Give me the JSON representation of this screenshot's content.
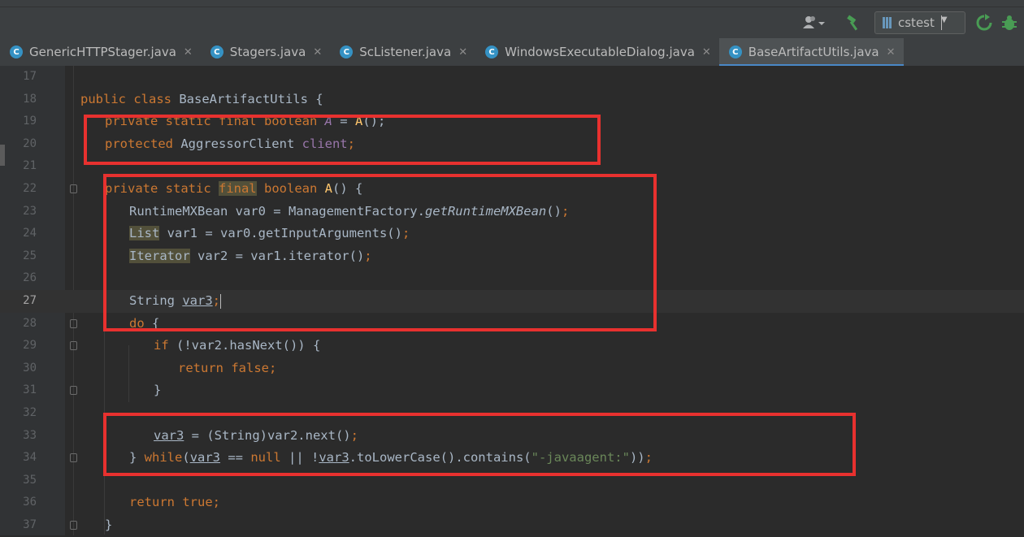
{
  "toolbar": {
    "run_config": "cstest"
  },
  "tabs": [
    {
      "label": "GenericHTTPStager.java",
      "active": false
    },
    {
      "label": "Stagers.java",
      "active": false
    },
    {
      "label": "ScListener.java",
      "active": false
    },
    {
      "label": "WindowsExecutableDialog.java",
      "active": false
    },
    {
      "label": "BaseArtifactUtils.java",
      "active": true
    }
  ],
  "icons": {
    "tab_class": "C",
    "tab_close": "✕"
  },
  "editor": {
    "line_numbers": [
      "17",
      "18",
      "19",
      "20",
      "21",
      "22",
      "23",
      "24",
      "25",
      "26",
      "27",
      "28",
      "29",
      "30",
      "31",
      "32",
      "33",
      "34",
      "35",
      "36",
      "37"
    ],
    "current_line": "27",
    "code": {
      "l18": {
        "kw": "public class ",
        "name": "BaseArtifactUtils",
        "rest": " {"
      },
      "l19": {
        "kw": "private static final boolean ",
        "fld": "A",
        "eq": " = ",
        "mth": "A",
        "rest": "();"
      },
      "l20": {
        "kw": "protected ",
        "type": "AggressorClient ",
        "fld": "client",
        "semi": ";"
      },
      "l22": {
        "kw1": "private static ",
        "kw2": "final",
        "kw3": " boolean ",
        "mth": "A",
        "rest": "() {"
      },
      "l23": {
        "a": "RuntimeMXBean var0 = ManagementFactory.",
        "b": "getRuntimeMXBean",
        "c": "()",
        "semi": ";"
      },
      "l24": {
        "a": "List",
        "b": " var1 = var0.getInputArguments()",
        "semi": ";"
      },
      "l25": {
        "a": "Iterator",
        "b": " var2 = var1.iterator()",
        "semi": ";"
      },
      "l27": {
        "a": "String ",
        "b": "var3",
        "semi": ";"
      },
      "l28": {
        "kw": "do ",
        "rest": "{"
      },
      "l29": {
        "kw": "if ",
        "rest": "(!var2.hasNext()) {"
      },
      "l30": {
        "kw": "return false",
        "semi": ";"
      },
      "l31": {
        "rest": "}"
      },
      "l33": {
        "a": "var3",
        "b": " = (String)var2.next()",
        "semi": ";"
      },
      "l34": {
        "a": "} ",
        "kw": "while",
        "b": "(",
        "v1": "var3",
        "c": " == ",
        "nul": "null",
        "d": " || !",
        "v2": "var3",
        "e": ".toLowerCase().contains(",
        "str": "\"-javaagent:\"",
        "f": "))",
        "semi": ";"
      },
      "l36": {
        "kw": "return true",
        "semi": ";"
      },
      "l37": {
        "rest": "}"
      }
    }
  }
}
